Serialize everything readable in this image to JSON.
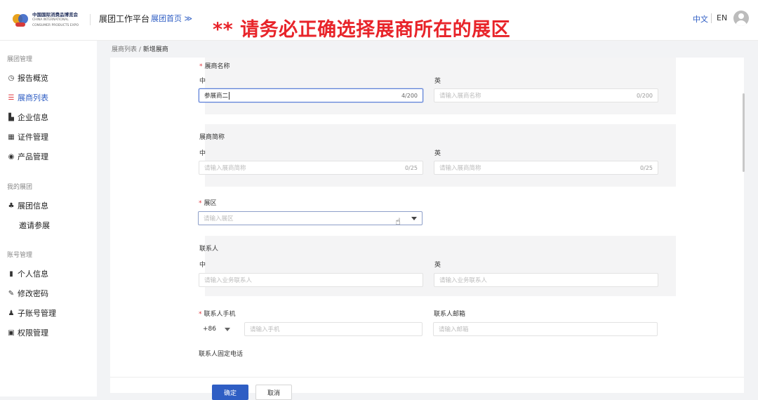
{
  "header": {
    "logo_cn": "中国国际消费品博览会",
    "logo_en1": "CHINA INTERNATIONAL",
    "logo_en2": "CONSUMER PRODUCTS EXPO",
    "platform": "展团工作平台",
    "home_link": "展团首页 ≫",
    "banner": "** 请务必正确选择展商所在的展区",
    "lang_zh": "中文",
    "lang_en": "EN"
  },
  "sidebar": {
    "sections": [
      {
        "title": "展团管理",
        "items": [
          {
            "label": "报告概览",
            "icon": "clock-icon",
            "glyph": "◷"
          },
          {
            "label": "展商列表",
            "icon": "list-icon",
            "glyph": "☰"
          },
          {
            "label": "企业信息",
            "icon": "building-icon",
            "glyph": "▙"
          },
          {
            "label": "证件管理",
            "icon": "id-card-icon",
            "glyph": "▦"
          },
          {
            "label": "产品管理",
            "icon": "product-icon",
            "glyph": "◉"
          }
        ]
      },
      {
        "title": "我的展团",
        "items": [
          {
            "label": "展团信息",
            "icon": "org-icon",
            "glyph": "♣"
          },
          {
            "label": "邀请参展",
            "icon": "",
            "glyph": ""
          }
        ]
      },
      {
        "title": "账号管理",
        "items": [
          {
            "label": "个人信息",
            "icon": "document-icon",
            "glyph": "▮"
          },
          {
            "label": "修改密码",
            "icon": "key-icon",
            "glyph": "✎"
          },
          {
            "label": "子账号管理",
            "icon": "user-icon",
            "glyph": "♟"
          },
          {
            "label": "权限管理",
            "icon": "lock-icon",
            "glyph": "▣"
          }
        ]
      }
    ]
  },
  "breadcrumb": {
    "parent": "展商列表",
    "sep": " / ",
    "current": "新增展商"
  },
  "form": {
    "exhibitor_name": {
      "label": "展商名称",
      "zh_label": "中",
      "zh_value": "参展商二",
      "zh_count": "4/200",
      "en_label": "英",
      "en_placeholder": "请输入展商名称",
      "en_count": "0/200"
    },
    "short_name": {
      "label": "展商简称",
      "zh_label": "中",
      "zh_placeholder": "请输入展商简称",
      "zh_count": "0/25",
      "en_label": "英",
      "en_placeholder": "请输入展商简称",
      "en_count": "0/25"
    },
    "zone": {
      "label": "展区",
      "placeholder": "请输入展区"
    },
    "contact": {
      "label": "联系人",
      "zh_label": "中",
      "zh_placeholder": "请输入业务联系人",
      "en_label": "英",
      "en_placeholder": "请输入业务联系人"
    },
    "mobile": {
      "label": "联系人手机",
      "code": "+86",
      "placeholder": "请输入手机"
    },
    "email": {
      "label": "联系人邮箱",
      "placeholder": "请输入邮箱"
    },
    "landline": {
      "label": "联系人固定电话"
    }
  },
  "actions": {
    "ok": "确定",
    "cancel": "取消"
  },
  "colors": {
    "accent": "#2f5ec4",
    "banner": "#e8242a",
    "required": "#e0383f"
  }
}
